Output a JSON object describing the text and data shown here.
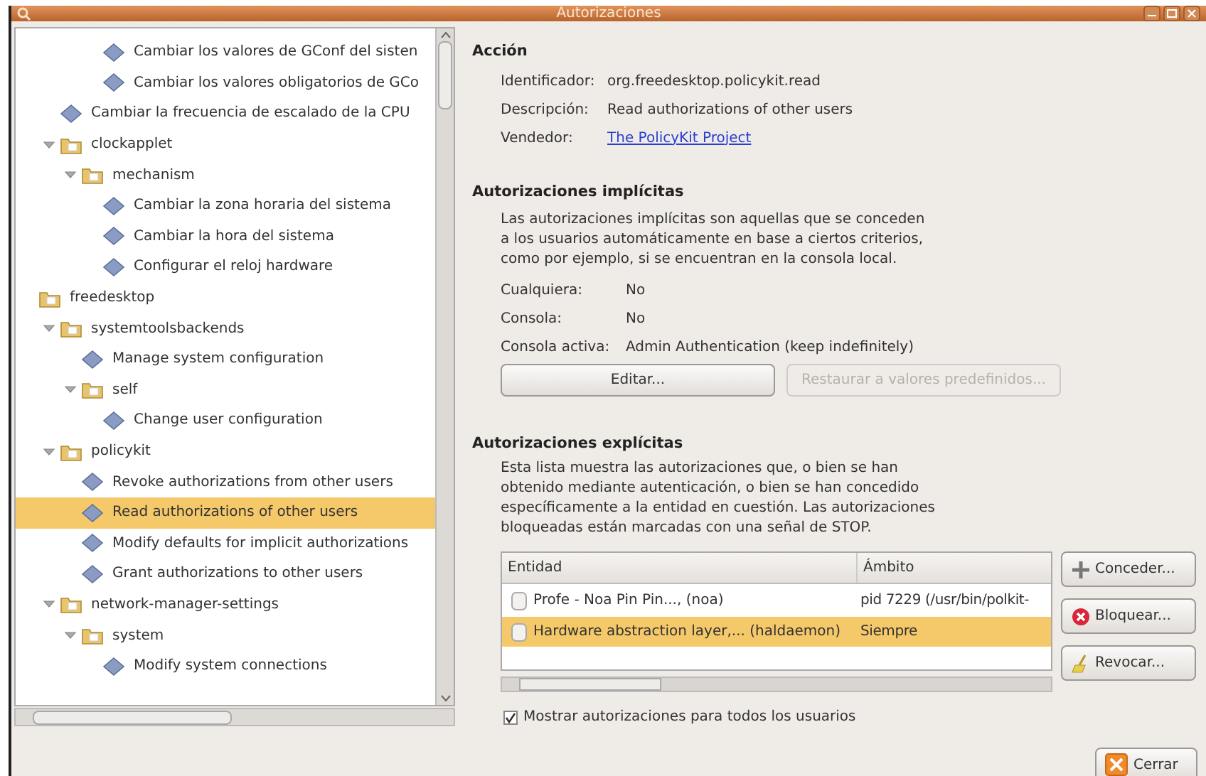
{
  "window": {
    "title": "Autorizaciones"
  },
  "tree": [
    {
      "children": [
        {
          "children": [
            {
              "children": [
                {
                  "kind": "action",
                  "label": "Cambiar los valores de GConf del sisten",
                  "selected": false
                },
                {
                  "kind": "action",
                  "label": "Cambiar los valores obligatorios de GCo",
                  "selected": false
                }
              ]
            }
          ]
        },
        {
          "kind": "action",
          "label": "Cambiar la frecuencia de escalado de la CPU",
          "selected": false
        },
        {
          "kind": "folder",
          "label": "clockapplet",
          "expanded": true,
          "selected": false,
          "children": [
            {
              "kind": "folder",
              "label": "mechanism",
              "expanded": true,
              "selected": false,
              "children": [
                {
                  "kind": "action",
                  "label": "Cambiar la zona horaria del sistema",
                  "selected": false
                },
                {
                  "kind": "action",
                  "label": "Cambiar la hora del sistema",
                  "selected": false
                },
                {
                  "kind": "action",
                  "label": "Configurar el reloj hardware",
                  "selected": false
                }
              ]
            }
          ]
        }
      ]
    },
    {
      "kind": "folder",
      "label": "freedesktop",
      "selected": false,
      "children": [
        {
          "kind": "folder",
          "label": "systemtoolsbackends",
          "expanded": true,
          "selected": false,
          "children": [
            {
              "kind": "action",
              "label": "Manage system configuration",
              "selected": false
            },
            {
              "kind": "folder",
              "label": "self",
              "expanded": true,
              "selected": false,
              "children": [
                {
                  "kind": "action",
                  "label": "Change user configuration",
                  "selected": false
                }
              ]
            }
          ]
        },
        {
          "kind": "folder",
          "label": "policykit",
          "expanded": true,
          "selected": false,
          "children": [
            {
              "kind": "action",
              "label": "Revoke authorizations from other users",
              "selected": false
            },
            {
              "kind": "action",
              "label": "Read authorizations of other users",
              "selected": true
            },
            {
              "kind": "action",
              "label": "Modify defaults for implicit authorizations",
              "selected": false
            },
            {
              "kind": "action",
              "label": "Grant authorizations to other users",
              "selected": false
            }
          ]
        },
        {
          "kind": "folder",
          "label": "network-manager-settings",
          "expanded": true,
          "selected": false,
          "children": [
            {
              "kind": "folder",
              "label": "system",
              "expanded": true,
              "selected": false,
              "children": [
                {
                  "kind": "action",
                  "label": "Modify system connections",
                  "selected": false
                }
              ]
            }
          ]
        }
      ]
    }
  ],
  "action": {
    "heading": "Acción",
    "fields": [
      {
        "label": "Identificador:",
        "value": "org.freedesktop.policykit.read",
        "kind": "text"
      },
      {
        "label": "Descripción:",
        "value": "Read authorizations of other users",
        "kind": "text"
      },
      {
        "label": "Vendedor:",
        "value": "The PolicyKit Project",
        "kind": "link"
      }
    ]
  },
  "implicit": {
    "heading": "Autorizaciones implícitas",
    "description": "Las autorizaciones implícitas son aquellas que se conceden a los usuarios automáticamente en base a ciertos criterios, como por ejemplo, si se encuentran en la consola local.",
    "fields": [
      {
        "label": "Cualquiera:",
        "value": "No"
      },
      {
        "label": "Consola:",
        "value": "No"
      },
      {
        "label": "Consola activa:",
        "value": "Admin Authentication (keep indefinitely)"
      }
    ],
    "buttons": [
      {
        "label": "Editar...",
        "disabled": false
      },
      {
        "label": "Restaurar a valores predefinidos...",
        "disabled": true
      }
    ]
  },
  "explicit": {
    "heading": "Autorizaciones explícitas",
    "description": "Esta lista muestra las autorizaciones que, o bien se han obtenido mediante autenticación, o bien se han concedido específicamente a la entidad en cuestión. Las autorizaciones bloqueadas están marcadas con una señal de STOP.",
    "table": {
      "columns": [
        "Entidad",
        "Ámbito"
      ],
      "rows": [
        {
          "cells": [
            "Profe - Noa Pin Pin..., (noa)",
            "pid 7229 (/usr/bin/polkit-"
          ],
          "selected": false
        },
        {
          "cells": [
            "Hardware abstraction layer,... (haldaemon)",
            "Siempre"
          ],
          "selected": true
        }
      ]
    },
    "buttons": [
      {
        "label": "Conceder...",
        "kind": "add"
      },
      {
        "label": "Bloquear...",
        "kind": "block"
      },
      {
        "label": "Revocar...",
        "kind": "revoke"
      }
    ],
    "show_all": {
      "label": "Mostrar autorizaciones para todos los usuarios",
      "checked": true
    }
  },
  "close_button": {
    "label": "Cerrar"
  }
}
